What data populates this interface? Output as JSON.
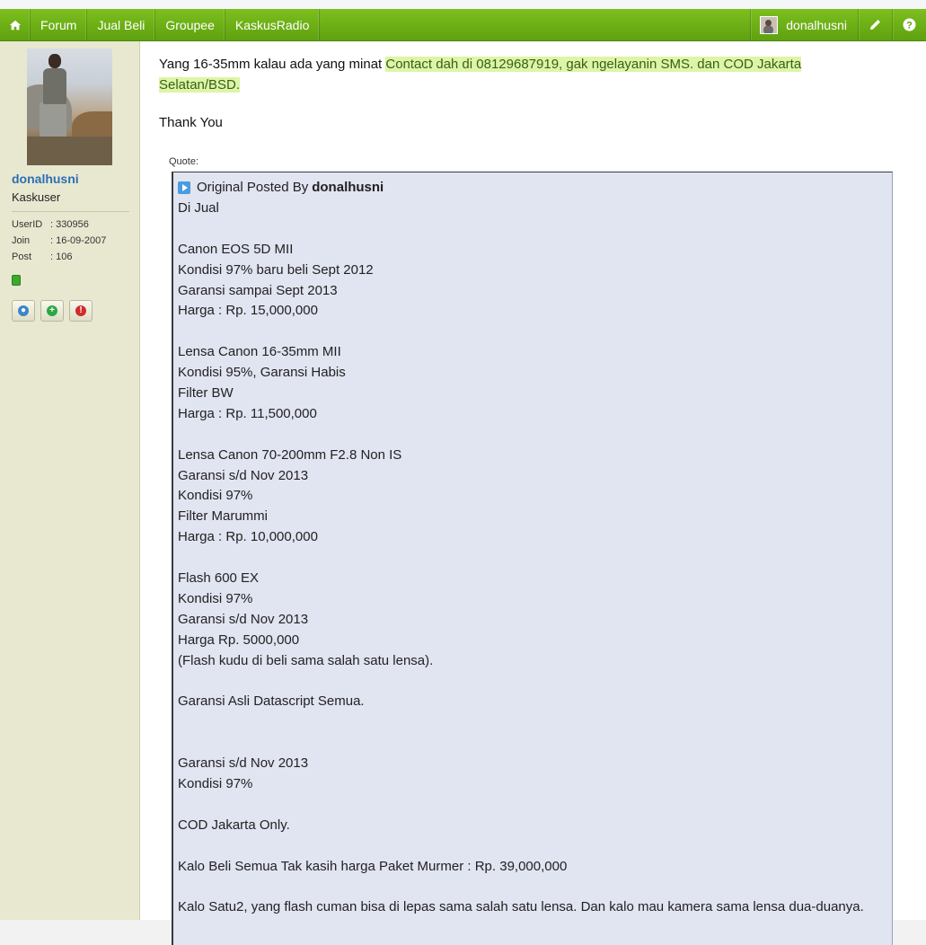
{
  "nav": {
    "items": [
      "Forum",
      "Jual Beli",
      "Groupee",
      "KaskusRadio"
    ],
    "username": "donalhusni",
    "accent": "#6aaf16"
  },
  "sidebar": {
    "username": "donalhusni",
    "rank": "Kaskuser",
    "userid_label": "UserID",
    "userid": ": 330956",
    "join_label": "Join",
    "join": ": 16-09-2007",
    "post_label": "Post",
    "post": ": 106"
  },
  "post": {
    "intro": "Yang 16-35mm kalau ada yang minat ",
    "highlight": "Contact dah di 08129687919, gak ngelayanin SMS. dan COD Jakarta Selatan/BSD.",
    "thanks": "Thank You",
    "quote_label": "Quote:",
    "quote_prefix": "Original Posted By",
    "quote_author": "donalhusni",
    "quote_lines": [
      "Di Jual",
      "",
      "Canon EOS 5D MII",
      "Kondisi 97% baru beli Sept 2012",
      "Garansi sampai Sept 2013",
      "Harga : Rp. 15,000,000",
      "",
      "Lensa Canon 16-35mm MII",
      "Kondisi 95%, Garansi Habis",
      "Filter BW",
      "Harga : Rp. 11,500,000",
      "",
      "Lensa Canon 70-200mm F2.8 Non IS",
      "Garansi s/d Nov 2013",
      "Kondisi 97%",
      "Filter Marummi",
      "Harga : Rp. 10,000,000",
      "",
      "Flash 600 EX",
      "Kondisi 97%",
      "Garansi s/d Nov 2013",
      "Harga Rp. 5000,000",
      "(Flash kudu di beli sama salah satu lensa).",
      "",
      "Garansi Asli Datascript Semua.",
      "",
      "",
      "Garansi s/d Nov 2013",
      "Kondisi 97%",
      "",
      "COD Jakarta Only.",
      "",
      "Kalo Beli Semua Tak kasih harga Paket Murmer : Rp. 39,000,000",
      "",
      "Kalo Satu2, yang flash cuman bisa di lepas sama salah satu lensa. Dan kalo mau kamera sama lensa dua-duanya."
    ]
  }
}
